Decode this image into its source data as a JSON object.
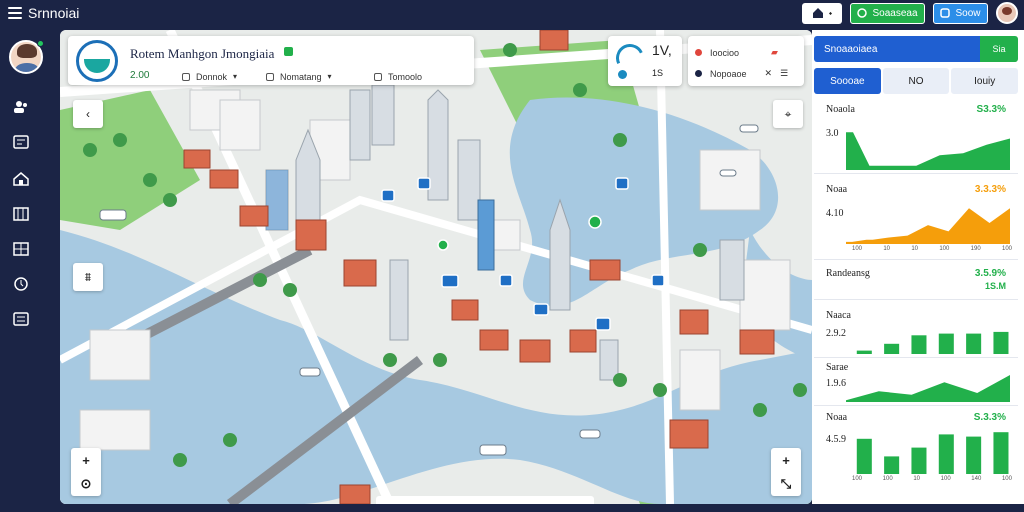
{
  "app": {
    "title": "Srnnoiai",
    "actions": {
      "green_label": "Soaaseaa",
      "blue_label": "Soow"
    }
  },
  "sidebar": {
    "items": [
      {
        "icon": "users-icon"
      },
      {
        "icon": "dashboard-icon"
      },
      {
        "icon": "home-icon"
      },
      {
        "icon": "map-icon"
      },
      {
        "icon": "grid-icon"
      },
      {
        "icon": "clock-icon"
      },
      {
        "icon": "settings-icon"
      }
    ]
  },
  "map_header": {
    "title": "Rotem Manhgon Jmongiaia",
    "stat": "2.00",
    "chips": [
      "Donnok",
      "Nomatang",
      "Tomoolo"
    ]
  },
  "weather": {
    "value": "1V,",
    "sub": "1S"
  },
  "location_card": {
    "rows": [
      {
        "label": "Ioocioo",
        "color": "#e0463c"
      },
      {
        "label": "Nopoaoe",
        "color": "#1b2445"
      }
    ]
  },
  "panel": {
    "header": "Snoaaoiaea",
    "header_button": "Sia",
    "tabs": [
      "Soooae",
      "NO",
      "Iouiy"
    ],
    "metrics": [
      {
        "label": "Noaola",
        "value": "3.0",
        "change": "S3.3%",
        "change_color": "#22b04b",
        "chart_color": "#22b04b",
        "chart": "area-bar",
        "values": [
          0.9,
          0.1,
          0.1,
          0.1,
          0.35,
          0.4,
          0.6,
          0.75
        ]
      },
      {
        "label": "Noaa",
        "value": "4.10",
        "change": "3.3.3%",
        "change_color": "#f59e0b",
        "chart_color": "#f59e0b",
        "chart": "area-bar",
        "values": [
          0.05,
          0.1,
          0.15,
          0.2,
          0.45,
          0.3,
          0.85,
          0.5,
          0.85
        ],
        "x_labels": [
          "100",
          "10",
          "10",
          "100",
          "190",
          "100"
        ]
      },
      {
        "label": "Randeansg",
        "value": "",
        "change": "3.5.9%",
        "change_color": "#22b04b",
        "sub": "1S.M",
        "sub_color": "#22b04b"
      },
      {
        "label": "Naaca",
        "value": "2.9.2",
        "change": "",
        "change_color": "#22b04b",
        "chart_color": "#22b04b",
        "chart": "bars",
        "values": [
          0.1,
          0.3,
          0.55,
          0.6,
          0.6,
          0.65
        ]
      },
      {
        "label": "Sarae",
        "value": "1.9.6",
        "change": "",
        "change_color": "#22b04b",
        "chart_color": "#22b04b",
        "chart": "area",
        "values": [
          0.05,
          0.3,
          0.2,
          0.55,
          0.25,
          0.75
        ]
      },
      {
        "label": "Noaa",
        "value": "4.5.9",
        "change": "S.3.3%",
        "change_color": "#22b04b",
        "chart_color": "#22b04b",
        "chart": "bars",
        "values": [
          0.8,
          0.4,
          0.6,
          0.9,
          0.85,
          0.95
        ],
        "x_labels": [
          "100",
          "100",
          "10",
          "100",
          "140",
          "100"
        ]
      }
    ]
  }
}
